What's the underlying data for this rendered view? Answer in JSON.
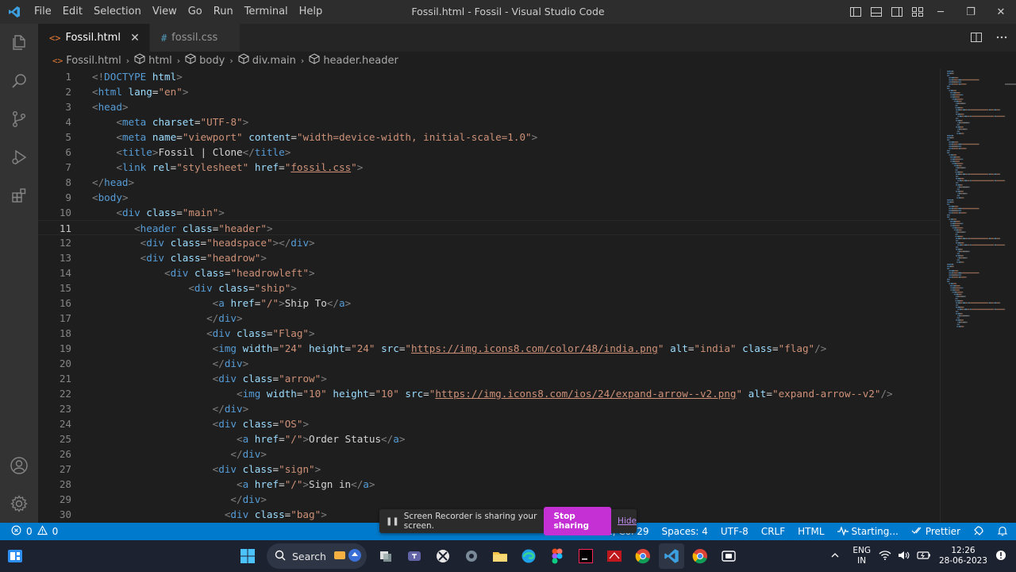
{
  "titlebar": {
    "menu": [
      "File",
      "Edit",
      "Selection",
      "View",
      "Go",
      "Run",
      "Terminal",
      "Help"
    ],
    "title": "Fossil.html - Fossil - Visual Studio Code",
    "minimize": "─",
    "restore": "❐",
    "close": "✕"
  },
  "tabs": [
    {
      "icon": "<>",
      "label": "Fossil.html",
      "close": "✕"
    },
    {
      "icon": "#",
      "label": "fossil.css"
    }
  ],
  "breadcrumb": [
    "Fossil.html",
    "html",
    "body",
    "div.main",
    "header.header"
  ],
  "editor": {
    "current_line": 11,
    "lines": [
      {
        "n": "1",
        "tokens": [
          [
            "br",
            "<!"
          ],
          [
            "tag",
            "DOCTYPE"
          ],
          [
            "txt",
            " "
          ],
          [
            "attr",
            "html"
          ],
          [
            "br",
            ">"
          ]
        ]
      },
      {
        "n": "2",
        "tokens": [
          [
            "br",
            "<"
          ],
          [
            "tag",
            "html"
          ],
          [
            "txt",
            " "
          ],
          [
            "attr",
            "lang"
          ],
          [
            "txt",
            "="
          ],
          [
            "str",
            "\"en\""
          ],
          [
            "br",
            ">"
          ]
        ]
      },
      {
        "n": "3",
        "tokens": [
          [
            "br",
            "<"
          ],
          [
            "tag",
            "head"
          ],
          [
            "br",
            ">"
          ]
        ]
      },
      {
        "n": "4",
        "tokens": [
          [
            "txt",
            "    "
          ],
          [
            "br",
            "<"
          ],
          [
            "tag",
            "meta"
          ],
          [
            "txt",
            " "
          ],
          [
            "attr",
            "charset"
          ],
          [
            "txt",
            "="
          ],
          [
            "str",
            "\"UTF-8\""
          ],
          [
            "br",
            ">"
          ]
        ]
      },
      {
        "n": "5",
        "tokens": [
          [
            "txt",
            "    "
          ],
          [
            "br",
            "<"
          ],
          [
            "tag",
            "meta"
          ],
          [
            "txt",
            " "
          ],
          [
            "attr",
            "name"
          ],
          [
            "txt",
            "="
          ],
          [
            "str",
            "\"viewport\""
          ],
          [
            "txt",
            " "
          ],
          [
            "attr",
            "content"
          ],
          [
            "txt",
            "="
          ],
          [
            "str",
            "\"width=device-width, initial-scale=1.0\""
          ],
          [
            "br",
            ">"
          ]
        ]
      },
      {
        "n": "6",
        "tokens": [
          [
            "txt",
            "    "
          ],
          [
            "br",
            "<"
          ],
          [
            "tag",
            "title"
          ],
          [
            "br",
            ">"
          ],
          [
            "txt",
            "Fossil | Clone"
          ],
          [
            "br",
            "</"
          ],
          [
            "tag",
            "title"
          ],
          [
            "br",
            ">"
          ]
        ]
      },
      {
        "n": "7",
        "tokens": [
          [
            "txt",
            "    "
          ],
          [
            "br",
            "<"
          ],
          [
            "tag",
            "link"
          ],
          [
            "txt",
            " "
          ],
          [
            "attr",
            "rel"
          ],
          [
            "txt",
            "="
          ],
          [
            "str",
            "\"stylesheet\""
          ],
          [
            "txt",
            " "
          ],
          [
            "attr",
            "href"
          ],
          [
            "txt",
            "="
          ],
          [
            "str",
            "\""
          ],
          [
            "link",
            "fossil.css"
          ],
          [
            "str",
            "\""
          ],
          [
            "br",
            ">"
          ]
        ]
      },
      {
        "n": "8",
        "tokens": [
          [
            "br",
            "</"
          ],
          [
            "tag",
            "head"
          ],
          [
            "br",
            ">"
          ]
        ]
      },
      {
        "n": "9",
        "tokens": [
          [
            "br",
            "<"
          ],
          [
            "tag",
            "body"
          ],
          [
            "br",
            ">"
          ]
        ]
      },
      {
        "n": "10",
        "tokens": [
          [
            "txt",
            "    "
          ],
          [
            "br",
            "<"
          ],
          [
            "tag",
            "div"
          ],
          [
            "txt",
            " "
          ],
          [
            "attr",
            "class"
          ],
          [
            "txt",
            "="
          ],
          [
            "str",
            "\"main\""
          ],
          [
            "br",
            ">"
          ]
        ]
      },
      {
        "n": "11",
        "tokens": [
          [
            "txt",
            "       "
          ],
          [
            "br",
            "<"
          ],
          [
            "tag",
            "header"
          ],
          [
            "txt",
            " "
          ],
          [
            "attr",
            "class"
          ],
          [
            "txt",
            "="
          ],
          [
            "str",
            "\"header\""
          ],
          [
            "br",
            ">"
          ]
        ]
      },
      {
        "n": "12",
        "tokens": [
          [
            "txt",
            "        "
          ],
          [
            "br",
            "<"
          ],
          [
            "tag",
            "div"
          ],
          [
            "txt",
            " "
          ],
          [
            "attr",
            "class"
          ],
          [
            "txt",
            "="
          ],
          [
            "str",
            "\"headspace\""
          ],
          [
            "br",
            "></"
          ],
          [
            "tag",
            "div"
          ],
          [
            "br",
            ">"
          ]
        ]
      },
      {
        "n": "13",
        "tokens": [
          [
            "txt",
            "        "
          ],
          [
            "br",
            "<"
          ],
          [
            "tag",
            "div"
          ],
          [
            "txt",
            " "
          ],
          [
            "attr",
            "class"
          ],
          [
            "txt",
            "="
          ],
          [
            "str",
            "\"headrow\""
          ],
          [
            "br",
            ">"
          ]
        ]
      },
      {
        "n": "14",
        "tokens": [
          [
            "txt",
            "            "
          ],
          [
            "br",
            "<"
          ],
          [
            "tag",
            "div"
          ],
          [
            "txt",
            " "
          ],
          [
            "attr",
            "class"
          ],
          [
            "txt",
            "="
          ],
          [
            "str",
            "\"headrowleft\""
          ],
          [
            "br",
            ">"
          ]
        ]
      },
      {
        "n": "15",
        "tokens": [
          [
            "txt",
            "                "
          ],
          [
            "br",
            "<"
          ],
          [
            "tag",
            "div"
          ],
          [
            "txt",
            " "
          ],
          [
            "attr",
            "class"
          ],
          [
            "txt",
            "="
          ],
          [
            "str",
            "\"ship\""
          ],
          [
            "br",
            ">"
          ]
        ]
      },
      {
        "n": "16",
        "tokens": [
          [
            "txt",
            "                    "
          ],
          [
            "br",
            "<"
          ],
          [
            "tag",
            "a"
          ],
          [
            "txt",
            " "
          ],
          [
            "attr",
            "href"
          ],
          [
            "txt",
            "="
          ],
          [
            "str",
            "\"/\""
          ],
          [
            "br",
            ">"
          ],
          [
            "txt",
            "Ship To"
          ],
          [
            "br",
            "</"
          ],
          [
            "tag",
            "a"
          ],
          [
            "br",
            ">"
          ]
        ]
      },
      {
        "n": "17",
        "tokens": [
          [
            "txt",
            "                   "
          ],
          [
            "br",
            "</"
          ],
          [
            "tag",
            "div"
          ],
          [
            "br",
            ">"
          ]
        ]
      },
      {
        "n": "18",
        "tokens": [
          [
            "txt",
            "                   "
          ],
          [
            "br",
            "<"
          ],
          [
            "tag",
            "div"
          ],
          [
            "txt",
            " "
          ],
          [
            "attr",
            "class"
          ],
          [
            "txt",
            "="
          ],
          [
            "str",
            "\"Flag\""
          ],
          [
            "br",
            ">"
          ]
        ]
      },
      {
        "n": "19",
        "tokens": [
          [
            "txt",
            "                    "
          ],
          [
            "br",
            "<"
          ],
          [
            "tag",
            "img"
          ],
          [
            "txt",
            " "
          ],
          [
            "attr",
            "width"
          ],
          [
            "txt",
            "="
          ],
          [
            "str",
            "\"24\""
          ],
          [
            "txt",
            " "
          ],
          [
            "attr",
            "height"
          ],
          [
            "txt",
            "="
          ],
          [
            "str",
            "\"24\""
          ],
          [
            "txt",
            " "
          ],
          [
            "attr",
            "src"
          ],
          [
            "txt",
            "="
          ],
          [
            "str",
            "\""
          ],
          [
            "link",
            "https://img.icons8.com/color/48/india.png"
          ],
          [
            "str",
            "\""
          ],
          [
            "txt",
            " "
          ],
          [
            "attr",
            "alt"
          ],
          [
            "txt",
            "="
          ],
          [
            "str",
            "\"india\""
          ],
          [
            "txt",
            " "
          ],
          [
            "attr",
            "class"
          ],
          [
            "txt",
            "="
          ],
          [
            "str",
            "\"flag\""
          ],
          [
            "br",
            "/>"
          ]
        ]
      },
      {
        "n": "20",
        "tokens": [
          [
            "txt",
            "                    "
          ],
          [
            "br",
            "</"
          ],
          [
            "tag",
            "div"
          ],
          [
            "br",
            ">"
          ]
        ]
      },
      {
        "n": "21",
        "tokens": [
          [
            "txt",
            "                    "
          ],
          [
            "br",
            "<"
          ],
          [
            "tag",
            "div"
          ],
          [
            "txt",
            " "
          ],
          [
            "attr",
            "class"
          ],
          [
            "txt",
            "="
          ],
          [
            "str",
            "\"arrow\""
          ],
          [
            "br",
            ">"
          ]
        ]
      },
      {
        "n": "22",
        "tokens": [
          [
            "txt",
            "                        "
          ],
          [
            "br",
            "<"
          ],
          [
            "tag",
            "img"
          ],
          [
            "txt",
            " "
          ],
          [
            "attr",
            "width"
          ],
          [
            "txt",
            "="
          ],
          [
            "str",
            "\"10\""
          ],
          [
            "txt",
            " "
          ],
          [
            "attr",
            "height"
          ],
          [
            "txt",
            "="
          ],
          [
            "str",
            "\"10\""
          ],
          [
            "txt",
            " "
          ],
          [
            "attr",
            "src"
          ],
          [
            "txt",
            "="
          ],
          [
            "str",
            "\""
          ],
          [
            "link",
            "https://img.icons8.com/ios/24/expand-arrow--v2.png"
          ],
          [
            "str",
            "\""
          ],
          [
            "txt",
            " "
          ],
          [
            "attr",
            "alt"
          ],
          [
            "txt",
            "="
          ],
          [
            "str",
            "\"expand-arrow--v2\""
          ],
          [
            "br",
            "/>"
          ]
        ]
      },
      {
        "n": "23",
        "tokens": [
          [
            "txt",
            "                    "
          ],
          [
            "br",
            "</"
          ],
          [
            "tag",
            "div"
          ],
          [
            "br",
            ">"
          ]
        ]
      },
      {
        "n": "24",
        "tokens": [
          [
            "txt",
            "                    "
          ],
          [
            "br",
            "<"
          ],
          [
            "tag",
            "div"
          ],
          [
            "txt",
            " "
          ],
          [
            "attr",
            "class"
          ],
          [
            "txt",
            "="
          ],
          [
            "str",
            "\"OS\""
          ],
          [
            "br",
            ">"
          ]
        ]
      },
      {
        "n": "25",
        "tokens": [
          [
            "txt",
            "                        "
          ],
          [
            "br",
            "<"
          ],
          [
            "tag",
            "a"
          ],
          [
            "txt",
            " "
          ],
          [
            "attr",
            "href"
          ],
          [
            "txt",
            "="
          ],
          [
            "str",
            "\"/\""
          ],
          [
            "br",
            ">"
          ],
          [
            "txt",
            "Order Status"
          ],
          [
            "br",
            "</"
          ],
          [
            "tag",
            "a"
          ],
          [
            "br",
            ">"
          ]
        ]
      },
      {
        "n": "26",
        "tokens": [
          [
            "txt",
            "                       "
          ],
          [
            "br",
            "</"
          ],
          [
            "tag",
            "div"
          ],
          [
            "br",
            ">"
          ]
        ]
      },
      {
        "n": "27",
        "tokens": [
          [
            "txt",
            "                    "
          ],
          [
            "br",
            "<"
          ],
          [
            "tag",
            "div"
          ],
          [
            "txt",
            " "
          ],
          [
            "attr",
            "class"
          ],
          [
            "txt",
            "="
          ],
          [
            "str",
            "\"sign\""
          ],
          [
            "br",
            ">"
          ]
        ]
      },
      {
        "n": "28",
        "tokens": [
          [
            "txt",
            "                        "
          ],
          [
            "br",
            "<"
          ],
          [
            "tag",
            "a"
          ],
          [
            "txt",
            " "
          ],
          [
            "attr",
            "href"
          ],
          [
            "txt",
            "="
          ],
          [
            "str",
            "\"/\""
          ],
          [
            "br",
            ">"
          ],
          [
            "txt",
            "Sign in"
          ],
          [
            "br",
            "</"
          ],
          [
            "tag",
            "a"
          ],
          [
            "br",
            ">"
          ]
        ]
      },
      {
        "n": "29",
        "tokens": [
          [
            "txt",
            "                       "
          ],
          [
            "br",
            "</"
          ],
          [
            "tag",
            "div"
          ],
          [
            "br",
            ">"
          ]
        ]
      },
      {
        "n": "30",
        "tokens": [
          [
            "txt",
            "                      "
          ],
          [
            "br",
            "<"
          ],
          [
            "tag",
            "div"
          ],
          [
            "txt",
            " "
          ],
          [
            "attr",
            "class"
          ],
          [
            "txt",
            "="
          ],
          [
            "str",
            "\"bag\""
          ],
          [
            "br",
            ">"
          ]
        ]
      }
    ]
  },
  "statusbar": {
    "errors": "0",
    "warnings": "0",
    "position": "Ln 11, Col 29",
    "position_visible": "1, Col 29",
    "spaces": "Spaces: 4",
    "encoding": "UTF-8",
    "eol": "CRLF",
    "language": "HTML",
    "live": "Starting...",
    "prettier": "Prettier"
  },
  "toast": {
    "message": "Screen Recorder is sharing your screen.",
    "stop_label": "Stop sharing",
    "hide_label": "Hide"
  },
  "taskbar": {
    "search_label": "Search",
    "lang_top": "ENG",
    "lang_bottom": "IN",
    "time": "12:26",
    "date": "28-06-2023"
  },
  "colors": {
    "accent": "#007acc",
    "stop_button": "#c430d4",
    "tag": "#569cd6",
    "attr": "#9cdcfe",
    "string": "#ce9178"
  }
}
